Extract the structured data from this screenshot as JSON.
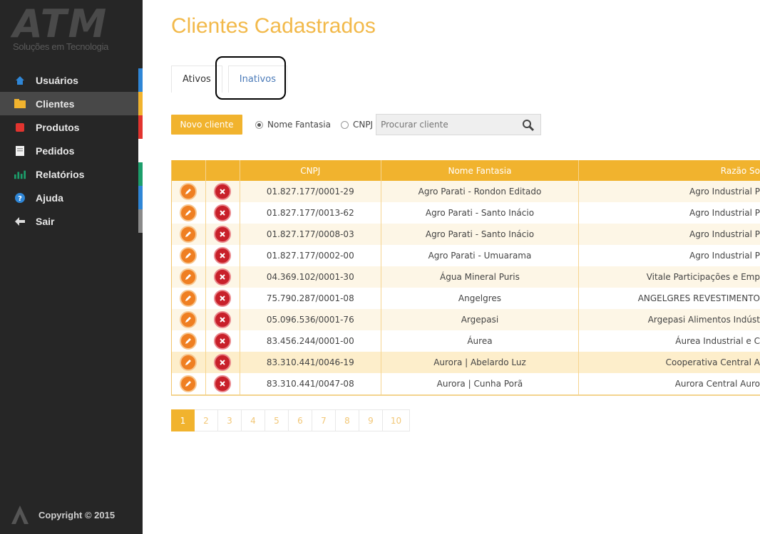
{
  "brand": {
    "logo_text": "ATM",
    "tagline": "Soluções em Tecnologia"
  },
  "sidebar": {
    "items": [
      {
        "label": "Usuários",
        "icon": "home-icon",
        "color": "#2f86d6"
      },
      {
        "label": "Clientes",
        "icon": "folder-icon",
        "color": "#f1b32e"
      },
      {
        "label": "Produtos",
        "icon": "box-icon",
        "color": "#e2342f"
      },
      {
        "label": "Pedidos",
        "icon": "document-icon",
        "color": "#ffffff"
      },
      {
        "label": "Relatórios",
        "icon": "chart-icon",
        "color": "#1c9e6b"
      },
      {
        "label": "Ajuda",
        "icon": "help-icon",
        "color": "#2f86d6"
      },
      {
        "label": "Sair",
        "icon": "arrow-left-icon",
        "color": "#8a8a8a"
      }
    ],
    "active_index": 1,
    "footer": "Copyright © 2015"
  },
  "page": {
    "title": "Clientes Cadastrados"
  },
  "tabs": [
    {
      "label": "Ativos"
    },
    {
      "label": "Inativos"
    }
  ],
  "toolbar": {
    "new_button": "Novo cliente",
    "radio_1": "Nome Fantasia",
    "radio_2": "CNPJ",
    "search_placeholder": "Procurar cliente"
  },
  "table": {
    "headers": [
      "",
      "",
      "CNPJ",
      "Nome Fantasia",
      "Razão So"
    ],
    "rows": [
      [
        "01.827.177/0001-29",
        "Agro Parati - Rondon Editado",
        "Agro Industrial P"
      ],
      [
        "01.827.177/0013-62",
        "Agro Parati - Santo Inácio",
        "Agro Industrial P"
      ],
      [
        "01.827.177/0008-03",
        "Agro Parati - Santo Inácio",
        "Agro Industrial P"
      ],
      [
        "01.827.177/0002-00",
        "Agro Parati - Umuarama",
        "Agro Industrial P"
      ],
      [
        "04.369.102/0001-30",
        "Água Mineral Puris",
        "Vitale Participações e Emp"
      ],
      [
        "75.790.287/0001-08",
        "Angelgres",
        "ANGELGRES REVESTIMENTO"
      ],
      [
        "05.096.536/0001-76",
        "Argepasi",
        "Argepasi Alimentos Indúst"
      ],
      [
        "83.456.244/0001-00",
        "Áurea",
        "Áurea Industrial e C"
      ],
      [
        "83.310.441/0046-19",
        "Aurora | Abelardo Luz",
        "Cooperativa Central A"
      ],
      [
        "83.310.441/0047-08",
        "Aurora | Cunha Porã",
        "Aurora Central Auro"
      ]
    ]
  },
  "pagination": {
    "pages": [
      "1",
      "2",
      "3",
      "4",
      "5",
      "6",
      "7",
      "8",
      "9",
      "10"
    ],
    "current": "1"
  },
  "colors": {
    "accent": "#f1b32e",
    "title": "#f2b94a",
    "sidebar": "#262626"
  }
}
